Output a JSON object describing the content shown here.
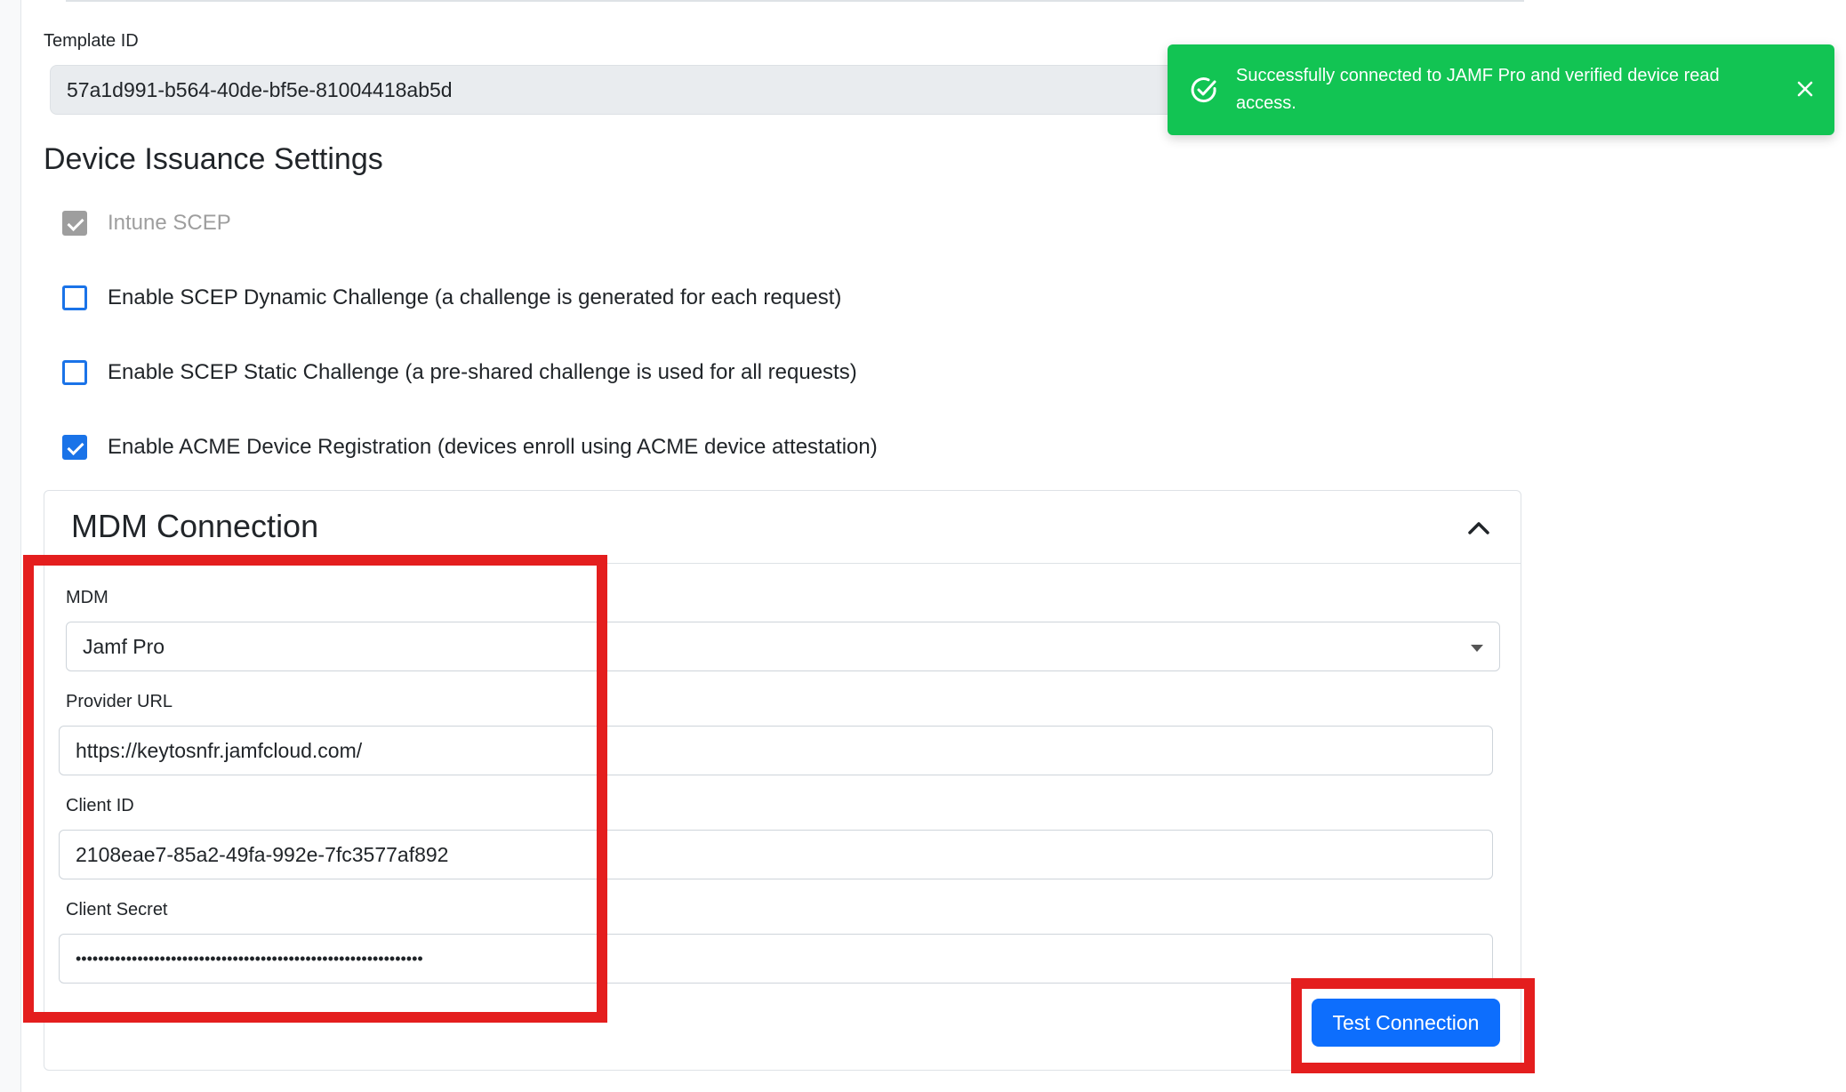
{
  "template": {
    "label": "Template ID",
    "value": "57a1d991-b564-40de-bf5e-81004418ab5d"
  },
  "issuance": {
    "title": "Device Issuance Settings",
    "options": [
      {
        "label": "Intune SCEP",
        "checked": true,
        "disabled": true
      },
      {
        "label": "Enable SCEP Dynamic Challenge (a challenge is generated for each request)",
        "checked": false,
        "disabled": false
      },
      {
        "label": "Enable SCEP Static Challenge (a pre-shared challenge is used for all requests)",
        "checked": false,
        "disabled": false
      },
      {
        "label": "Enable ACME Device Registration (devices enroll using ACME device attestation)",
        "checked": true,
        "disabled": false
      }
    ]
  },
  "mdm": {
    "title": "MDM Connection",
    "mdm_label": "MDM",
    "mdm_value": "Jamf Pro",
    "provider_url_label": "Provider URL",
    "provider_url_value": "https://keytosnfr.jamfcloud.com/",
    "client_id_label": "Client ID",
    "client_id_value": "2108eae7-85a2-49fa-992e-7fc3577af892",
    "client_secret_label": "Client Secret",
    "client_secret_value": "••••••••••••••••••••••••••••••••••••••••••••••••••••••••••••••",
    "test_button": "Test Connection"
  },
  "toast": {
    "message": "Successfully connected to JAMF Pro and verified device read access."
  },
  "colors": {
    "toast_bg": "#12c453",
    "primary": "#0d6efd",
    "highlight": "#e41e1e",
    "checkbox": "#1a73e8"
  },
  "icons": [
    "check-circle-icon",
    "close-icon",
    "chevron-up-icon",
    "caret-down-icon",
    "checkbox-checked-icon"
  ]
}
